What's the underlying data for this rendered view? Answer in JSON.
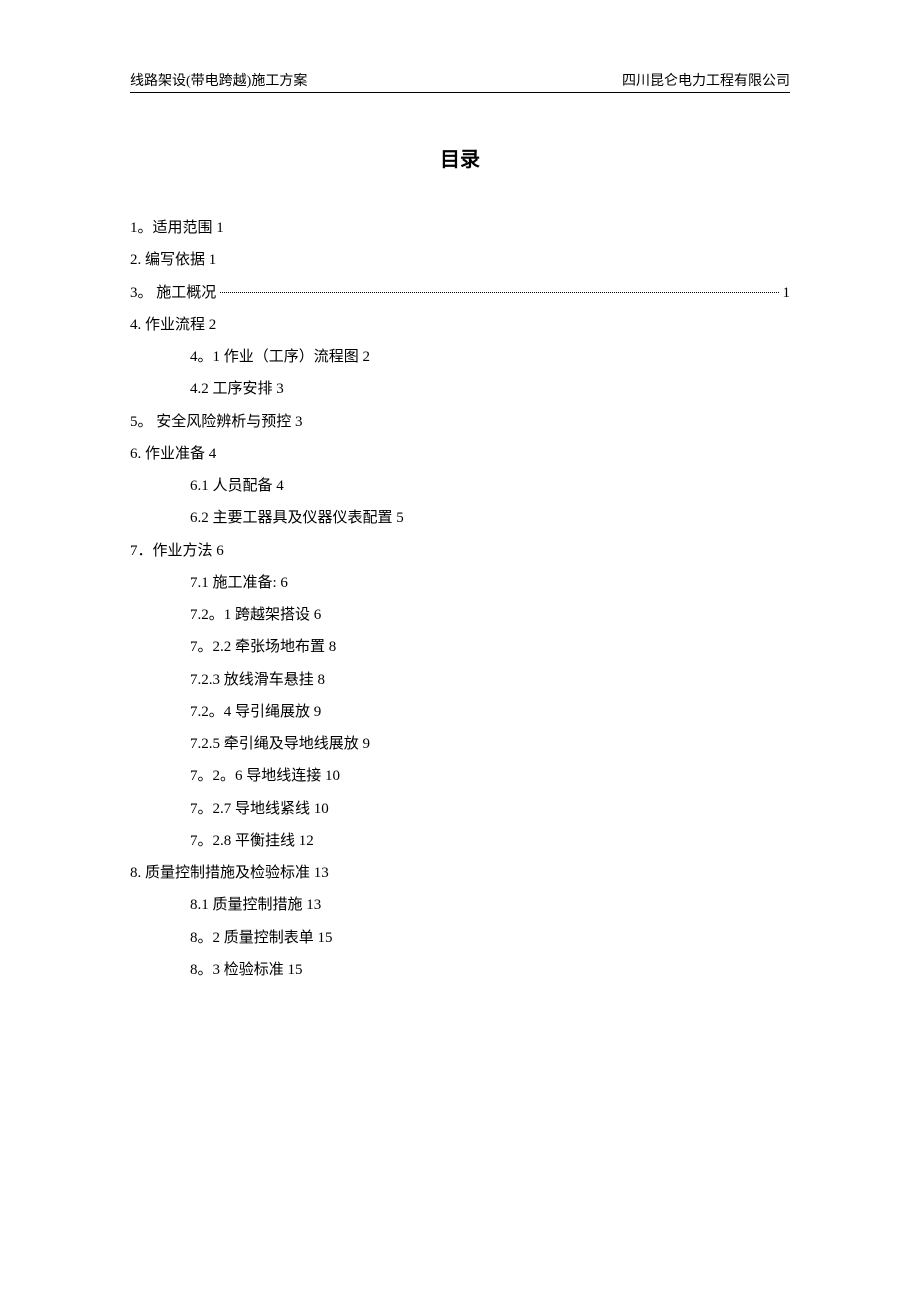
{
  "header": {
    "left": "线路架设(带电跨越)施工方案",
    "right": "四川昆仑电力工程有限公司"
  },
  "title": "目录",
  "toc": {
    "item1": "1。适用范围 1",
    "item2": "2. 编写依据 1",
    "item3_label": "3。 施工概况",
    "item3_page": "1",
    "item4": "4. 作业流程 2",
    "item4_1": "4。1 作业（工序）流程图 2",
    "item4_2": "4.2 工序安排 3",
    "item5": "5。 安全风险辨析与预控 3",
    "item6": "6. 作业准备 4",
    "item6_1": "6.1 人员配备 4",
    "item6_2": "6.2 主要工器具及仪器仪表配置 5",
    "item7": "7．作业方法 6",
    "item7_1": "7.1 施工准备: 6",
    "item7_2_1": "7.2。1 跨越架搭设 6",
    "item7_2_2": "7。2.2 牵张场地布置 8",
    "item7_2_3": "7.2.3 放线滑车悬挂 8",
    "item7_2_4": "7.2。4 导引绳展放 9",
    "item7_2_5": "7.2.5 牵引绳及导地线展放 9",
    "item7_2_6": "7。2。6 导地线连接 10",
    "item7_2_7": "7。2.7 导地线紧线 10",
    "item7_2_8": "7。2.8 平衡挂线 12",
    "item8": "8. 质量控制措施及检验标准 13",
    "item8_1": "8.1 质量控制措施 13",
    "item8_2": "8。2 质量控制表单 15",
    "item8_3": "8。3 检验标准 15"
  }
}
